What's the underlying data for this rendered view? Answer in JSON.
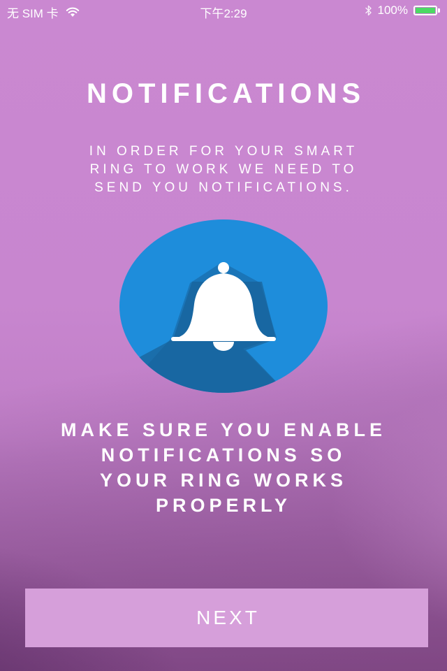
{
  "status_bar": {
    "carrier": "无 SIM 卡",
    "time": "下午2:29",
    "battery_percent": "100%",
    "battery_level": 1.0,
    "battery_color": "#4cd964"
  },
  "onboarding": {
    "title": "NOTIFICATIONS",
    "intro_lines": [
      "IN ORDER FOR YOUR SMART",
      "RING TO WORK WE NEED TO",
      "SEND YOU NOTIFICATIONS."
    ],
    "instruction_lines": [
      "MAKE SURE YOU ENABLE",
      "NOTIFICATIONS SO",
      "YOUR RING WORKS",
      "PROPERLY"
    ],
    "illustration_icon": "bell-icon",
    "next_label": "NEXT"
  },
  "colors": {
    "background": "#c987d0",
    "badge_blue": "#1e8ddb",
    "badge_shadow": "#1a6aa5",
    "button": "#d69fda",
    "text": "#ffffff"
  }
}
